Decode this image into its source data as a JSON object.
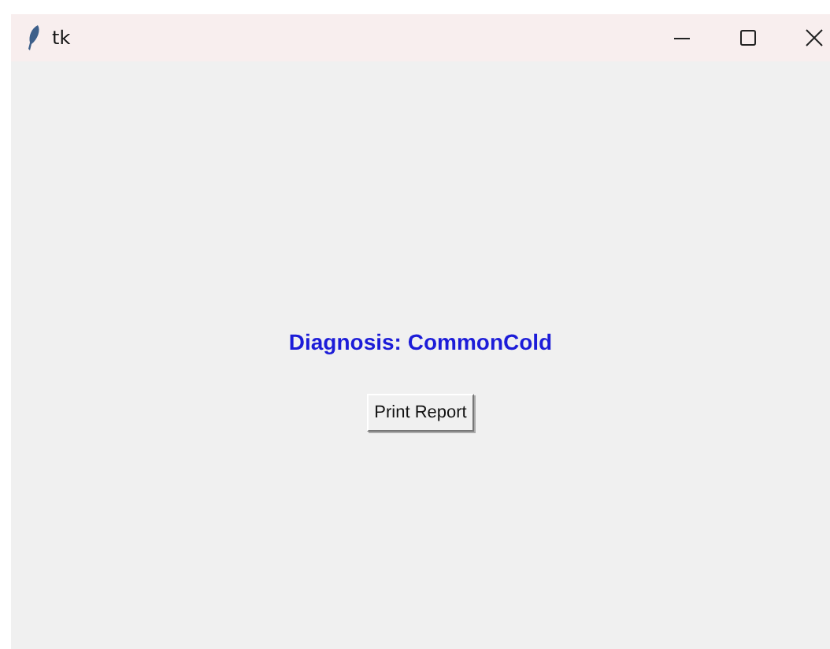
{
  "window": {
    "title": "tk"
  },
  "diagnosis": {
    "text": "Diagnosis: CommonCold"
  },
  "buttons": [
    "Print Report"
  ]
}
